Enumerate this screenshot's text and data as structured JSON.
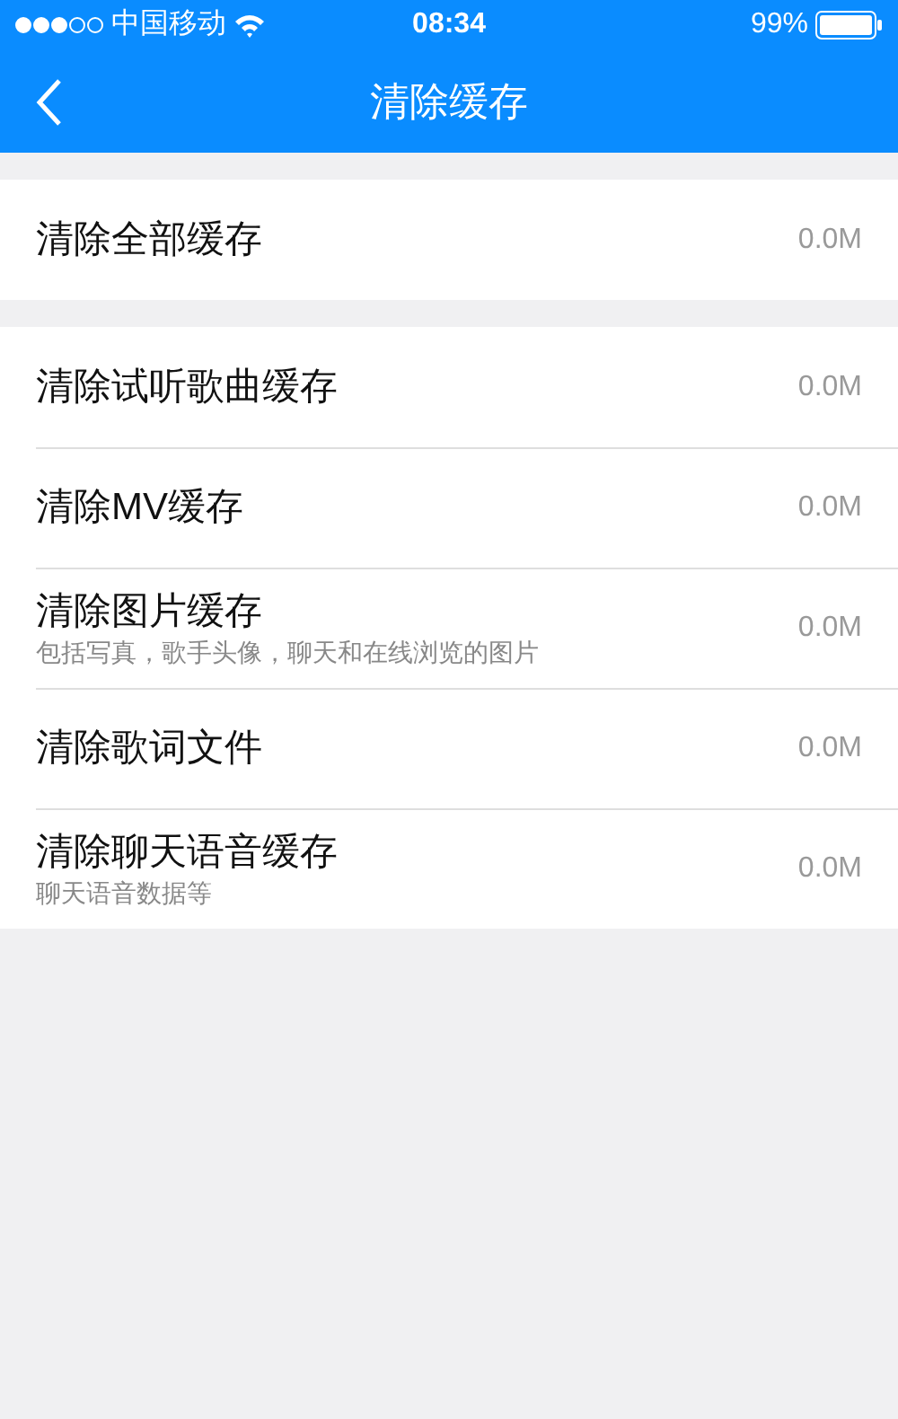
{
  "status_bar": {
    "carrier": "中国移动",
    "time": "08:34",
    "battery": "99%"
  },
  "header": {
    "title": "清除缓存"
  },
  "sections": [
    {
      "items": [
        {
          "title": "清除全部缓存",
          "value": "0.0M"
        }
      ]
    },
    {
      "items": [
        {
          "title": "清除试听歌曲缓存",
          "value": "0.0M"
        },
        {
          "title": "清除MV缓存",
          "value": "0.0M"
        },
        {
          "title": "清除图片缓存",
          "subtitle": "包括写真，歌手头像，聊天和在线浏览的图片",
          "value": "0.0M"
        },
        {
          "title": "清除歌词文件",
          "value": "0.0M"
        },
        {
          "title": "清除聊天语音缓存",
          "subtitle": "聊天语音数据等",
          "value": "0.0M"
        }
      ]
    }
  ]
}
